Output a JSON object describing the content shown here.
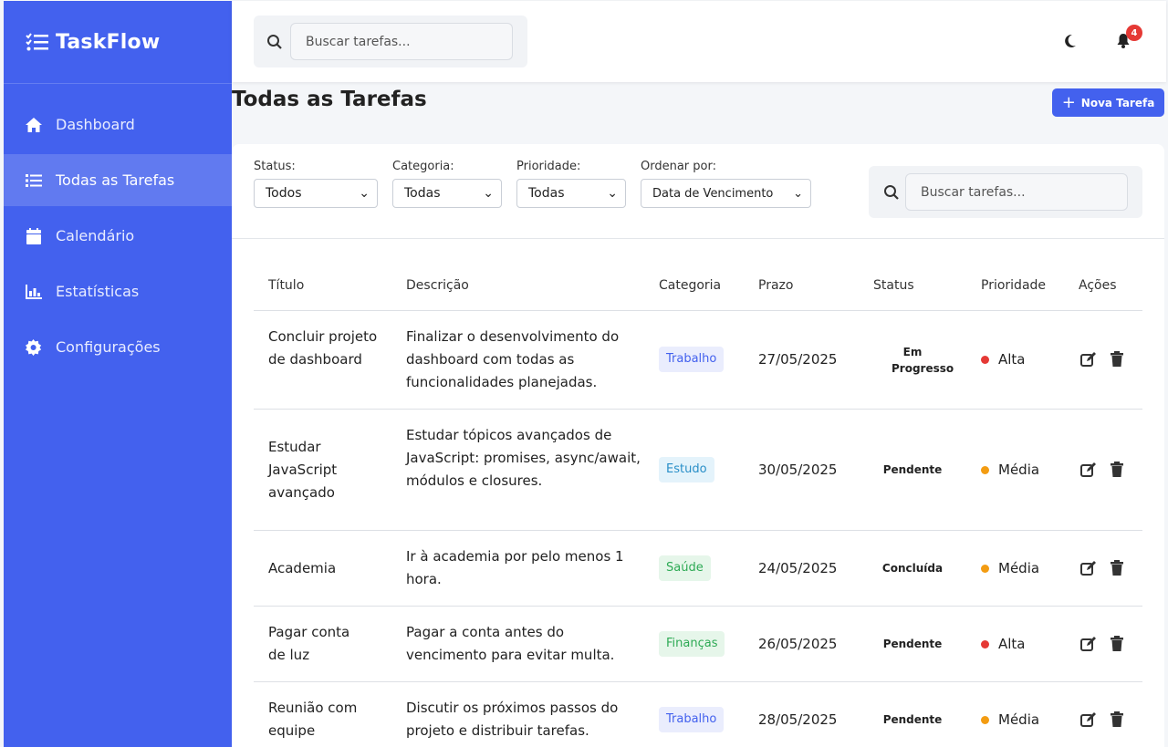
{
  "app": {
    "name": "TaskFlow"
  },
  "sidebar": {
    "items": [
      {
        "label": "Dashboard",
        "icon": "home-icon",
        "active": false
      },
      {
        "label": "Todas as Tarefas",
        "icon": "list-icon",
        "active": true
      },
      {
        "label": "Calendário",
        "icon": "calendar-icon",
        "active": false
      },
      {
        "label": "Estatísticas",
        "icon": "chart-icon",
        "active": false
      },
      {
        "label": "Configurações",
        "icon": "gear-icon",
        "active": false
      }
    ]
  },
  "header": {
    "search_placeholder": "Buscar tarefas...",
    "notification_count": "4"
  },
  "page": {
    "title": "Todas as Tarefas",
    "new_task_label": "Nova Tarefa"
  },
  "filters": {
    "status": {
      "label": "Status:",
      "value": "Todos"
    },
    "category": {
      "label": "Categoria:",
      "value": "Todas"
    },
    "priority": {
      "label": "Prioridade:",
      "value": "Todas"
    },
    "sort": {
      "label": "Ordenar por:",
      "value": "Data de Vencimento"
    },
    "search_placeholder": "Buscar tarefas..."
  },
  "table": {
    "headers": [
      "Título",
      "Descrição",
      "Categoria",
      "Prazo",
      "Status",
      "Prioridade",
      "Ações"
    ],
    "rows": [
      {
        "title": "Concluir projeto de dashboard",
        "description": "Finalizar o desenvolvimento do dashboard com todas as funcionalidades planejadas.",
        "category": "Trabalho",
        "due": "27/05/2025",
        "status": "Em Progresso",
        "priority": "Alta"
      },
      {
        "title": "Estudar JavaScript avançado",
        "description": "Estudar tópicos avançados de JavaScript: promises, async/await, módulos e closures.",
        "category": "Estudo",
        "due": "30/05/2025",
        "status": "Pendente",
        "priority": "Média"
      },
      {
        "title": "Academia",
        "description": "Ir à academia por pelo menos 1 hora.",
        "category": "Saúde",
        "due": "24/05/2025",
        "status": "Concluída",
        "priority": "Média"
      },
      {
        "title": "Pagar conta de luz",
        "description": "Pagar a conta antes do vencimento para evitar multa.",
        "category": "Finanças",
        "due": "26/05/2025",
        "status": "Pendente",
        "priority": "Alta"
      },
      {
        "title": "Reunião com equipe",
        "description": "Discutir os próximos passos do projeto e distribuir tarefas.",
        "category": "Trabalho",
        "due": "28/05/2025",
        "status": "Pendente",
        "priority": "Média"
      }
    ]
  },
  "colors": {
    "primary": "#4361ee",
    "priority_high": "#e53935",
    "priority_medium": "#f39c12"
  }
}
